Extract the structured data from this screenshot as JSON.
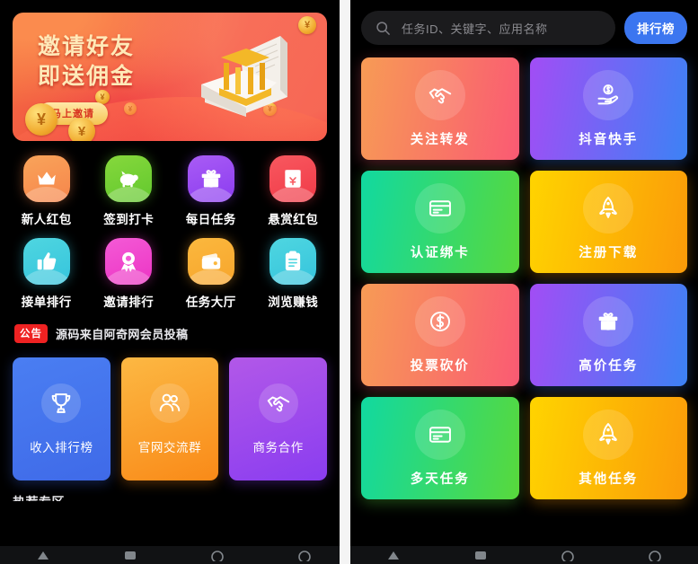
{
  "left_panel": {
    "banner": {
      "line1": "邀请好友",
      "line2": "即送佣金",
      "button": "马上邀请",
      "coin_symbol": "¥"
    },
    "quick_icons": [
      {
        "label": "新人红包",
        "icon": "crown-icon",
        "c1": "#f9a45a",
        "c2": "#f6854b"
      },
      {
        "label": "签到打卡",
        "icon": "piggy-icon",
        "c1": "#86d83c",
        "c2": "#62c82e"
      },
      {
        "label": "每日任务",
        "icon": "gift-icon",
        "c1": "#a95cf5",
        "c2": "#8b3cf0"
      },
      {
        "label": "悬赏红包",
        "icon": "redpacket-icon",
        "c1": "#f8585f",
        "c2": "#f03a48"
      },
      {
        "label": "接单排行",
        "icon": "thumb-icon",
        "c1": "#4fd6e0",
        "c2": "#35c4dd"
      },
      {
        "label": "邀请排行",
        "icon": "medal-icon",
        "c1": "#f45ad6",
        "c2": "#ec34c4"
      },
      {
        "label": "任务大厅",
        "icon": "wallet-icon",
        "c1": "#fbb83e",
        "c2": "#f7a52c"
      },
      {
        "label": "浏览赚钱",
        "icon": "clipboard-icon",
        "c1": "#4fd6e0",
        "c2": "#35c4dd"
      }
    ],
    "notice": {
      "badge": "公告",
      "text": "源码来自阿奇网会员投稿"
    },
    "promos": [
      {
        "label": "收入排行榜",
        "icon": "trophy-icon",
        "c1": "#4a7ef2",
        "c2": "#3f6ae8"
      },
      {
        "label": "官网交流群",
        "icon": "people-icon",
        "c1": "#fcb843",
        "c2": "#f98a18"
      },
      {
        "label": "商务合作",
        "icon": "handshake-icon",
        "c1": "#b258e8",
        "c2": "#8a3df0"
      }
    ],
    "section_title": "热荐专区"
  },
  "right_panel": {
    "search": {
      "placeholder": "任务ID、关键字、应用名称",
      "icon": "search-icon"
    },
    "rank_button": "排行榜",
    "categories": [
      {
        "label": "关注转发",
        "icon": "handshake-icon",
        "c1": "#f79b55",
        "c2": "#fa5a73"
      },
      {
        "label": "抖音快手",
        "icon": "hand-coin-icon",
        "c1": "#a24df5",
        "c2": "#3c82f5"
      },
      {
        "label": "认证绑卡",
        "icon": "card-icon",
        "c1": "#11d9a0",
        "c2": "#58d93c"
      },
      {
        "label": "注册下载",
        "icon": "rocket-icon",
        "c1": "#ffd400",
        "c2": "#fb9a09"
      },
      {
        "label": "投票砍价",
        "icon": "dollar-icon",
        "c1": "#f79b55",
        "c2": "#fa5a73"
      },
      {
        "label": "高价任务",
        "icon": "gift-icon",
        "c1": "#a24df5",
        "c2": "#3c82f5"
      },
      {
        "label": "多天任务",
        "icon": "card-icon",
        "c1": "#11d9a0",
        "c2": "#58d93c"
      },
      {
        "label": "其他任务",
        "icon": "rocket-icon",
        "c1": "#ffd400",
        "c2": "#fb9a09"
      }
    ]
  },
  "system_nav": {
    "back": "back-icon",
    "home": "home-icon",
    "recents": "recents-icon"
  }
}
